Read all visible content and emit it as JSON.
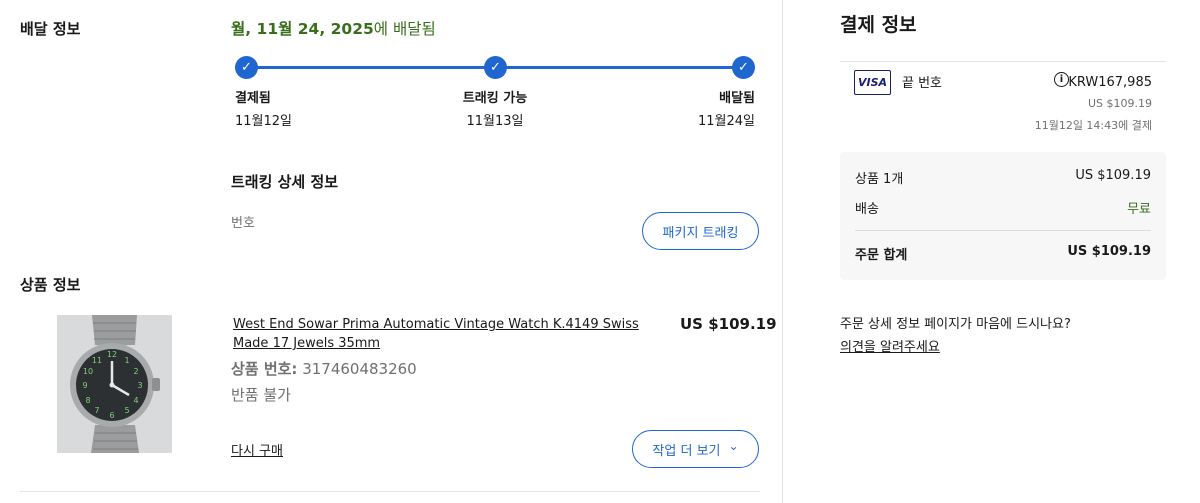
{
  "shipping": {
    "section_label": "배달 정보",
    "eta_bold": "월, 11월 24, 2025",
    "eta_suffix": "에 배달됨",
    "steps": [
      {
        "title": "결제됨",
        "date": "11월12일"
      },
      {
        "title": "트래킹 가능",
        "date": "11월13일"
      },
      {
        "title": "배달됨",
        "date": "11월24일"
      }
    ],
    "check_glyph": "✓",
    "tracking_title": "트래킹 상세 정보",
    "tracking_number_label": "번호",
    "track_button": "패키지 트래킹"
  },
  "product": {
    "section_label": "상품 정보",
    "title": "West End Sowar Prima Automatic Vintage Watch K.4149 Swiss Made 17 Jewels 35mm",
    "price": "US $109.19",
    "item_no_label": "상품 번호:",
    "item_no": "317460483260",
    "return_policy": "반품 불가",
    "buy_again": "다시 구매",
    "more_actions": "작업 더 보기",
    "more_chevron": "⌄"
  },
  "payment": {
    "title": "결제 정보",
    "card_brand": "VISA",
    "card_end_label": "끝 번호",
    "info_glyph": "i",
    "amount_krw": "KRW167,985",
    "amount_usd": "US $109.19",
    "paid_at": "11월12일 14:43에 결제",
    "summary": {
      "items_label": "상품 1개",
      "items_value": "US $109.19",
      "shipping_label": "배송",
      "shipping_value": "무료",
      "total_label": "주문 합계",
      "total_value": "US $109.19"
    },
    "feedback_question": "주문 상세 정보 페이지가 마음에 드시나요?",
    "feedback_link": "의견을 알려주세요"
  },
  "colors": {
    "accent_blue": "#1f66d1",
    "success_green": "#3a6e1c"
  }
}
